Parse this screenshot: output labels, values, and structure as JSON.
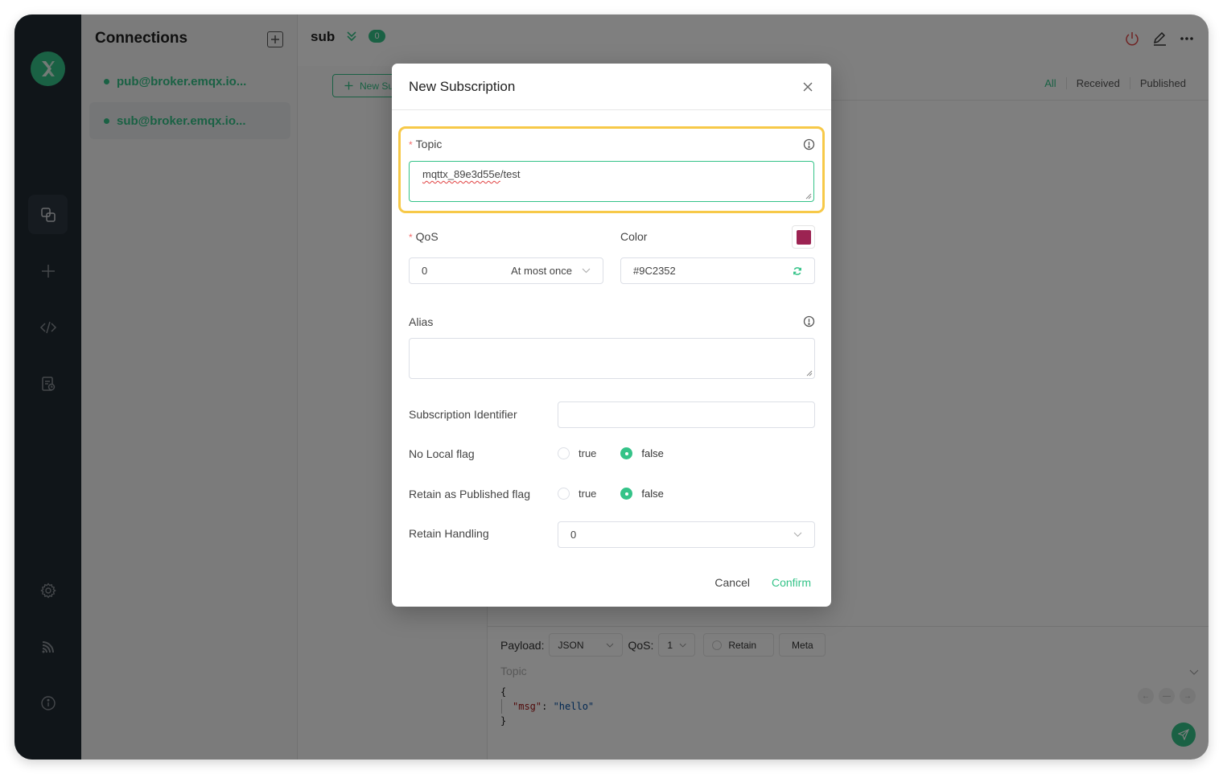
{
  "sidebar": {
    "logo": "mqttx-logo",
    "nav_icons": [
      "connections-icon",
      "add-icon",
      "script-icon",
      "log-icon",
      "settings-icon",
      "feed-icon",
      "about-icon"
    ]
  },
  "connections": {
    "title": "Connections",
    "items": [
      {
        "label": "pub@broker.emqx.io...",
        "status": "connected",
        "active": false
      },
      {
        "label": "sub@broker.emqx.io...",
        "status": "connected",
        "active": true
      }
    ]
  },
  "header": {
    "connection_name": "sub",
    "unread_count": "0"
  },
  "subscriptions": {
    "new_button_label": "New Subscription"
  },
  "message_filter": {
    "tabs": [
      "All",
      "Received",
      "Published"
    ],
    "active": "All"
  },
  "publish": {
    "payload_label": "Payload:",
    "payload_format": "JSON",
    "qos_label": "QoS:",
    "qos_value": "1",
    "retain_label": "Retain",
    "meta_label": "Meta",
    "topic_placeholder": "Topic",
    "payload_lines": {
      "open": "{",
      "key": "\"msg\"",
      "colon": ": ",
      "value": "\"hello\"",
      "close": "}"
    }
  },
  "dialog": {
    "title": "New Subscription",
    "topic": {
      "label": "Topic",
      "value_misspelled": "mqttx_89e3d55e",
      "value_rest": "/test"
    },
    "qos": {
      "label": "QoS",
      "value": "0",
      "description": "At most once"
    },
    "color": {
      "label": "Color",
      "value": "#9C2352",
      "swatch": "#9C2352"
    },
    "alias": {
      "label": "Alias",
      "value": ""
    },
    "subscription_identifier": {
      "label": "Subscription Identifier",
      "value": ""
    },
    "no_local": {
      "label": "No Local flag",
      "options": [
        "true",
        "false"
      ],
      "selected": "false"
    },
    "retain_as_published": {
      "label": "Retain as Published flag",
      "options": [
        "true",
        "false"
      ],
      "selected": "false"
    },
    "retain_handling": {
      "label": "Retain Handling",
      "value": "0"
    },
    "cancel_label": "Cancel",
    "confirm_label": "Confirm"
  },
  "colors": {
    "accent": "#34C388",
    "highlight": "#F7C948",
    "required": "#F56C6C",
    "disconnect": "#E04848"
  }
}
